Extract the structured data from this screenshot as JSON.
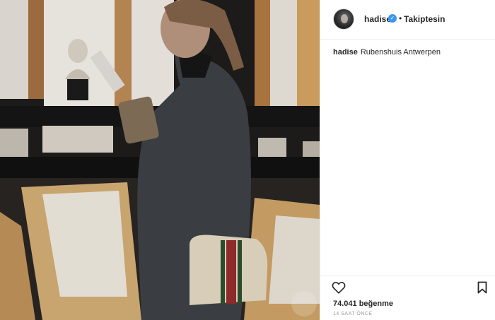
{
  "post": {
    "username": "hadise",
    "separator": "•",
    "follow_status": "Takiptesin",
    "verified_glyph": "✓",
    "caption_user": "hadise",
    "caption_text": "Rubenshuis Antwerpen",
    "likes": "74.041 beğenme",
    "timestamp": "14 SAAT ÖNCE"
  },
  "icons": {
    "verified": "verified-badge-icon",
    "like": "heart-icon",
    "save": "bookmark-icon"
  },
  "colors": {
    "text": "#262626",
    "verified": "#3897f0",
    "muted": "#999999",
    "border": "#efefef"
  }
}
